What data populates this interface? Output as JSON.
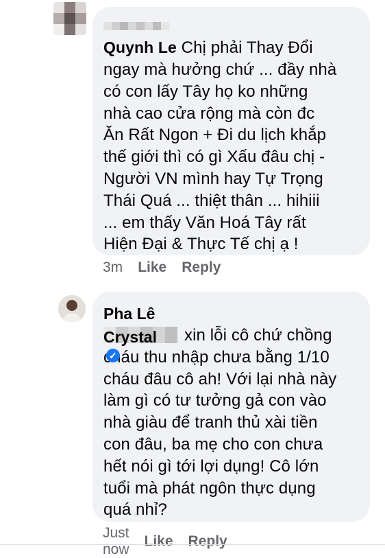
{
  "comments": [
    {
      "author": "Quynh Le",
      "text_lines": [
        "Chị phải Thay Đổi",
        "ngay mà hưởng chứ ... đầy nhà",
        "có con lấy Tây họ ko những",
        "nhà cao cửa rộng mà còn đc",
        "Ăn Rất Ngon + Đi du lịch khắp",
        "thế giới thì có gì Xấu đâu chị -",
        "Người VN mình hay Tự Trọng",
        "Thái Quá ... thiệt thân ... hihiii",
        "... em thấy Văn Hoá Tây rất",
        "Hiện Đại & Thực Tế chị ạ !"
      ],
      "time": "3m",
      "like_label": "Like",
      "reply_label": "Reply"
    },
    {
      "author": "Pha Lê Crystal",
      "verified_icon": "verified-badge-icon",
      "text_lines": [
        "xin lỗi cô chứ chồng",
        "cháu thu nhập chưa bằng 1/10",
        "cháu đâu cô ah! Với lại nhà này",
        "làm gì có tư tưởng gả con vào",
        "nhà giàu để tranh thủ xài tiền",
        "con đâu, ba mẹ cho con chưa",
        "hết nói gì tới lợi dụng! Cô lớn",
        "tuổi mà phát ngôn thực dụng",
        "quá nhỉ?"
      ],
      "time": "Just now",
      "like_label": "Like",
      "reply_label": "Reply"
    }
  ],
  "colors": {
    "bubble": "#f0f2f5",
    "meta_text": "#65676b",
    "verified": "#1877f2"
  }
}
